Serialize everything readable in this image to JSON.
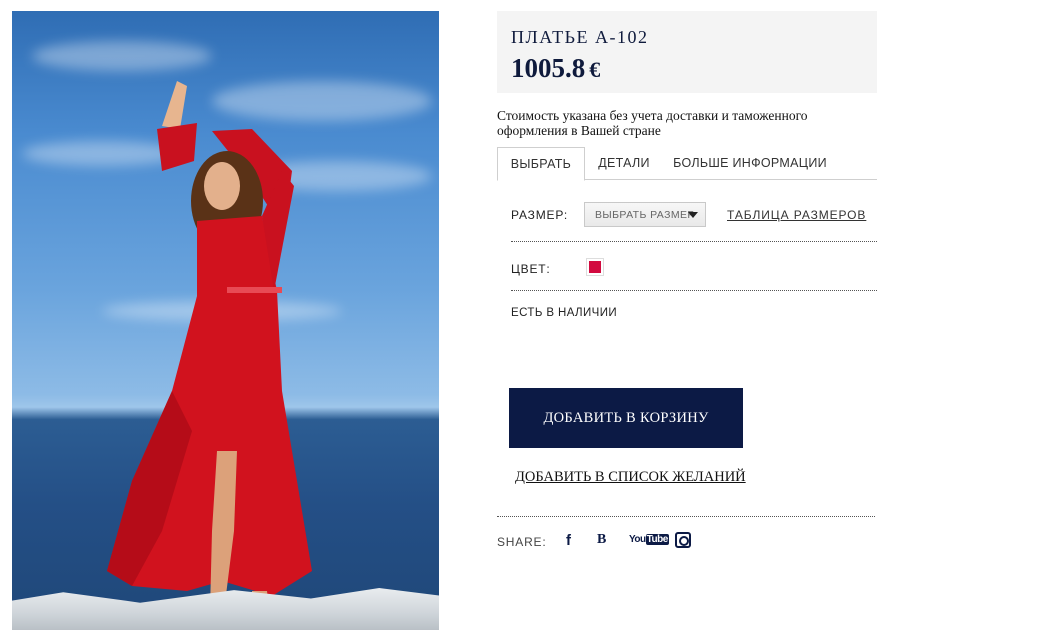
{
  "product": {
    "name": "ПЛАТЬЕ А-102",
    "price": "1005.8",
    "currency": "€",
    "note": "Стоимость указана без учета доставки и таможенного оформления в Вашей стране"
  },
  "tabs": [
    {
      "label": "ВЫБРАТЬ",
      "active": true
    },
    {
      "label": "ДЕТАЛИ",
      "active": false
    },
    {
      "label": "БОЛЬШЕ ИНФОРМАЦИИ",
      "active": false
    }
  ],
  "options": {
    "size_label": "РАЗМЕР:",
    "size_select_value": "ВЫБРАТЬ РАЗМЕР",
    "size_chart_link": "ТАБЛИЦА РАЗМЕРОВ",
    "color_label": "ЦВЕТ:",
    "color_swatch": "#d20a3f",
    "availability": "ЕСТЬ В НАЛИЧИИ"
  },
  "actions": {
    "add_to_cart": "ДОБАВИТЬ В КОРЗИНУ",
    "add_to_wishlist": "ДОБАВИТЬ В СПИСОК ЖЕЛАНИЙ"
  },
  "share": {
    "label": "SHARE:",
    "icons": [
      "facebook-icon",
      "vkontakte-icon",
      "youtube-icon",
      "instagram-icon"
    ],
    "youtube_text": "You",
    "youtube_tube": "Tube"
  },
  "colors": {
    "brand_navy": "#0c1a45",
    "dress_red": "#d20a3f"
  }
}
